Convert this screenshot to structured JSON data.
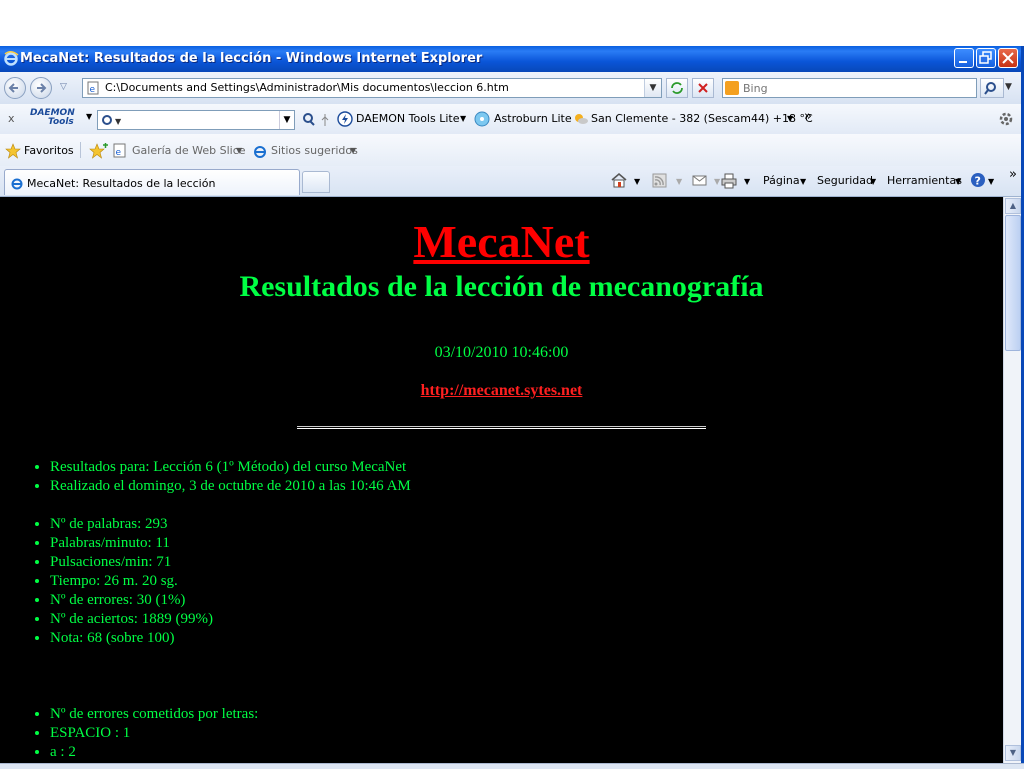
{
  "window": {
    "title": "MecaNet: Resultados de la lección - Windows Internet Explorer"
  },
  "address_bar": {
    "url": "C:\\Documents and Settings\\Administrador\\Mis documentos\\leccion 6.htm"
  },
  "search": {
    "placeholder": "Bing"
  },
  "toolbar": {
    "daemon_logo_line1": "DAEMON",
    "daemon_logo_line2": "Tools",
    "daemon_tools_lite": "DAEMON Tools Lite",
    "astroburn": "Astroburn Lite",
    "weather": "San Clemente - 382 (Sescam44) +18 °C",
    "more": "»"
  },
  "favorites_bar": {
    "favoritos": "Favoritos",
    "galeria": "Galería de Web Slice",
    "sitios": "Sitios sugeridos"
  },
  "tab": {
    "label": "MecaNet: Resultados de la lección"
  },
  "command_bar": {
    "pagina": "Página",
    "seguridad": "Seguridad",
    "herramientas": "Herramientas",
    "more": "»"
  },
  "page": {
    "title": "MecaNet",
    "subtitle": "Resultados de la lección de mecanografía",
    "datetime": "03/10/2010 10:46:00",
    "link": "http://mecanet.sytes.net",
    "info": [
      "Resultados para: Lección 6 (1º Método) del curso MecaNet",
      "Realizado el domingo, 3 de octubre de 2010 a las 10:46 AM"
    ],
    "stats": [
      "Nº de palabras: 293",
      "Palabras/minuto: 11",
      "Pulsaciones/min: 71",
      "Tiempo: 26 m. 20 sg.",
      "Nº de errores: 30 (1%)",
      "Nº de aciertos: 1889 (99%)",
      "Nota: 68 (sobre 100)"
    ],
    "errors_by_letter": [
      "Nº de errores cometidos por letras:",
      "ESPACIO : 1",
      "a : 2"
    ]
  },
  "colors": {
    "title_red": "#ff0000",
    "text_green": "#00ff44",
    "page_bg": "#000000",
    "titlebar_blue": "#0a55d8"
  }
}
